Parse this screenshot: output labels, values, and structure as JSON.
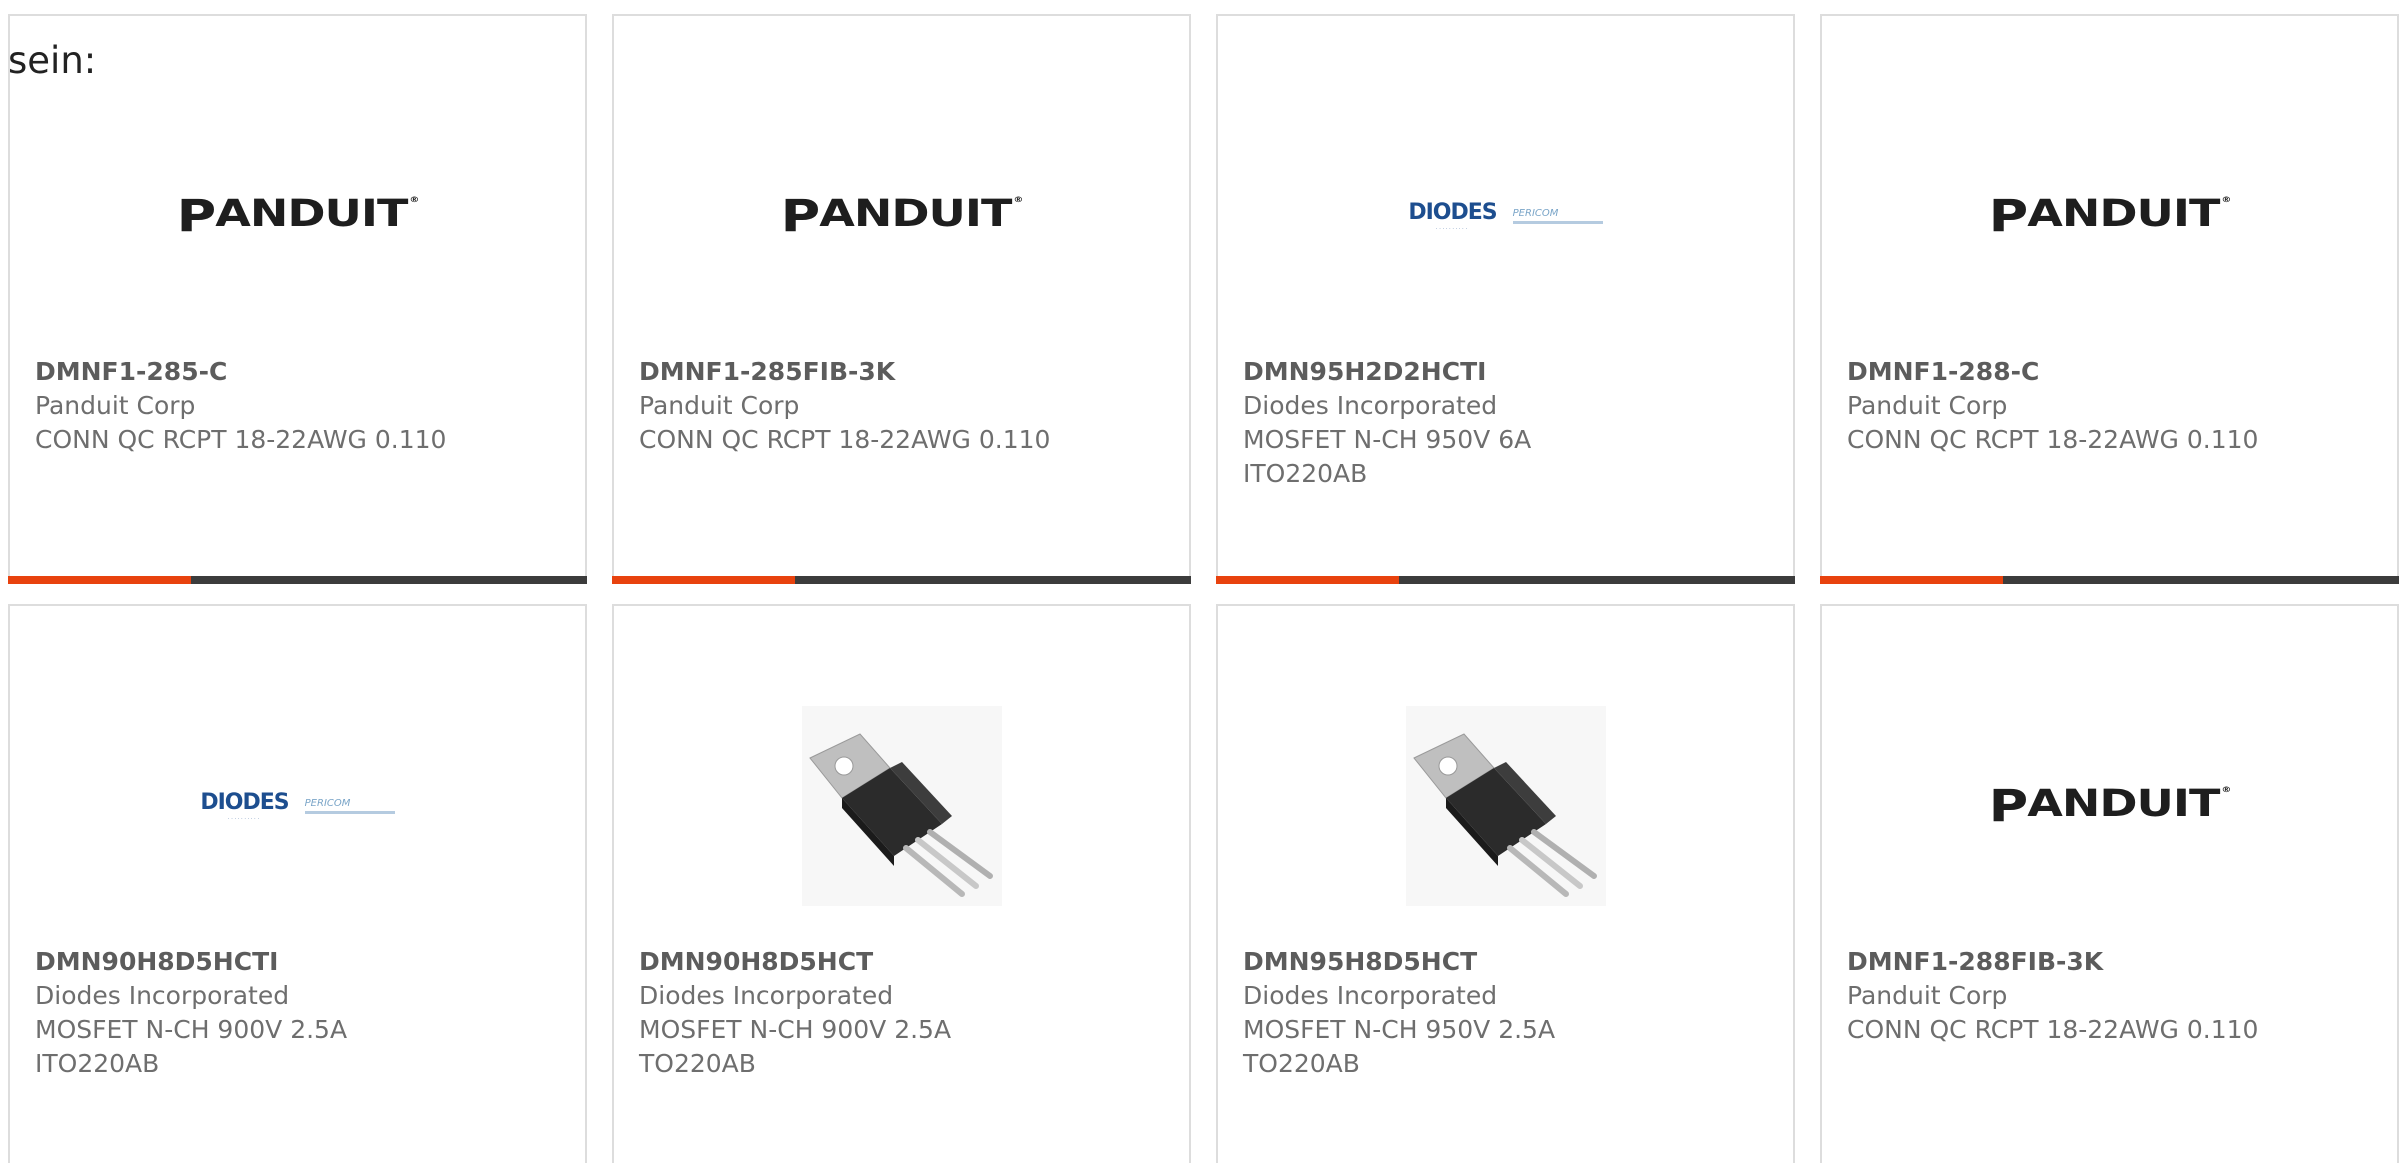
{
  "intro_text": "sein:",
  "colors": {
    "accent": "#e8420e",
    "bar": "#3c3c3c",
    "border": "#dddddd",
    "panduit": "#1e1e1e",
    "diodes": "#1d4e8f"
  },
  "cards": [
    {
      "part_number": "DMNF1-285-C",
      "manufacturer": "Panduit Corp",
      "description_lines": [
        "CONN QC RCPT 18-22AWG 0.110"
      ],
      "image": "panduit-logo",
      "logo_text": "PANDUIT"
    },
    {
      "part_number": "DMNF1-285FIB-3K",
      "manufacturer": "Panduit Corp",
      "description_lines": [
        "CONN QC RCPT 18-22AWG 0.110"
      ],
      "image": "panduit-logo",
      "logo_text": "PANDUIT"
    },
    {
      "part_number": "DMN95H2D2HCTI",
      "manufacturer": "Diodes Incorporated",
      "description_lines": [
        "MOSFET N-CH 950V 6A",
        "ITO220AB"
      ],
      "image": "diodes-logo",
      "logo_text": "DIODES",
      "logo_subtext": "PERICOM"
    },
    {
      "part_number": "DMNF1-288-C",
      "manufacturer": "Panduit Corp",
      "description_lines": [
        "CONN QC RCPT 18-22AWG 0.110"
      ],
      "image": "panduit-logo",
      "logo_text": "PANDUIT"
    },
    {
      "part_number": "DMN90H8D5HCTI",
      "manufacturer": "Diodes Incorporated",
      "description_lines": [
        "MOSFET N-CH 900V 2.5A",
        "ITO220AB"
      ],
      "image": "diodes-logo",
      "logo_text": "DIODES",
      "logo_subtext": "PERICOM"
    },
    {
      "part_number": "DMN90H8D5HCT",
      "manufacturer": "Diodes Incorporated",
      "description_lines": [
        "MOSFET N-CH 900V 2.5A",
        "TO220AB"
      ],
      "image": "to220-transistor-photo"
    },
    {
      "part_number": "DMN95H8D5HCT",
      "manufacturer": "Diodes Incorporated",
      "description_lines": [
        "MOSFET N-CH 950V 2.5A",
        "TO220AB"
      ],
      "image": "to220-transistor-photo"
    },
    {
      "part_number": "DMNF1-288FIB-3K",
      "manufacturer": "Panduit Corp",
      "description_lines": [
        "CONN QC RCPT 18-22AWG 0.110"
      ],
      "image": "panduit-logo",
      "logo_text": "PANDUIT"
    }
  ]
}
